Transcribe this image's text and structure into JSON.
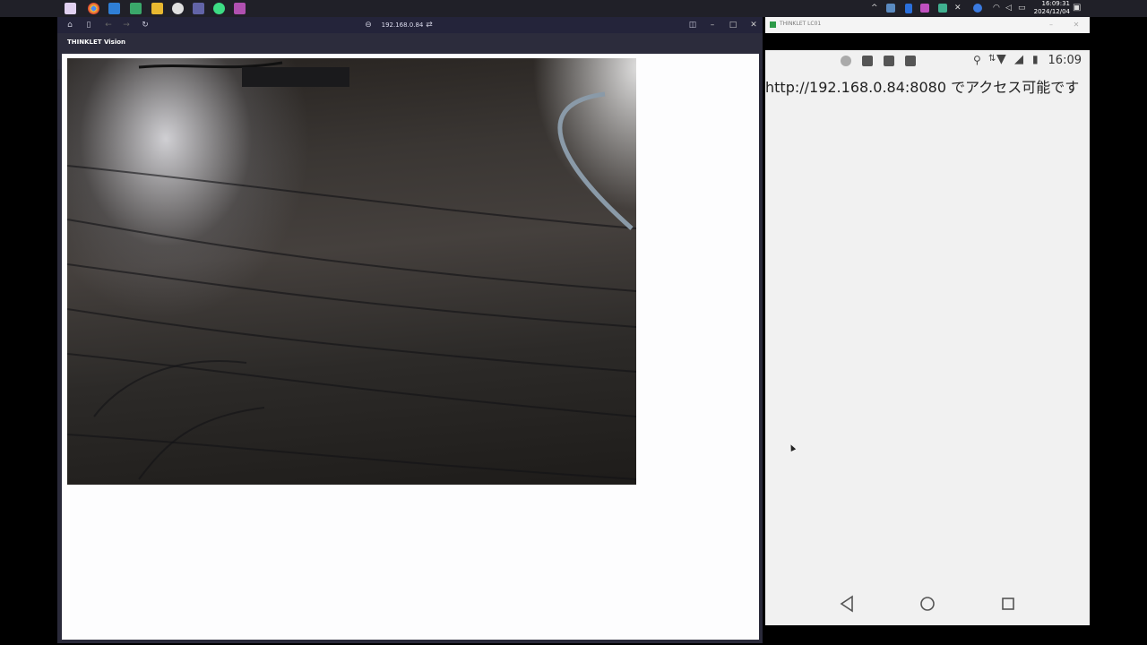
{
  "taskbar": {
    "apps": [
      {
        "name": "start-icon",
        "color": "#c8a8e8"
      },
      {
        "name": "chrome-icon",
        "color": "#f0c040"
      },
      {
        "name": "vscode-icon",
        "color": "#3a8ee6"
      },
      {
        "name": "git-icon",
        "color": "#4caf50"
      },
      {
        "name": "folder-icon",
        "color": "#e8b830"
      },
      {
        "name": "github-icon",
        "color": "#dddddd"
      },
      {
        "name": "teams-icon",
        "color": "#6264a7"
      },
      {
        "name": "android-studio-icon",
        "color": "#3ddc84"
      },
      {
        "name": "slack-icon",
        "color": "#c060c0"
      }
    ],
    "clock_time": "16:09:31",
    "clock_date": "2024/12/04"
  },
  "browser": {
    "address": "192.168.0.84",
    "page_title": "THINKLET Vision"
  },
  "phone": {
    "window_title": "THINKLET LC01",
    "status_time": "16:09",
    "message": "http://192.168.0.84:8080 でアクセス可能です"
  }
}
